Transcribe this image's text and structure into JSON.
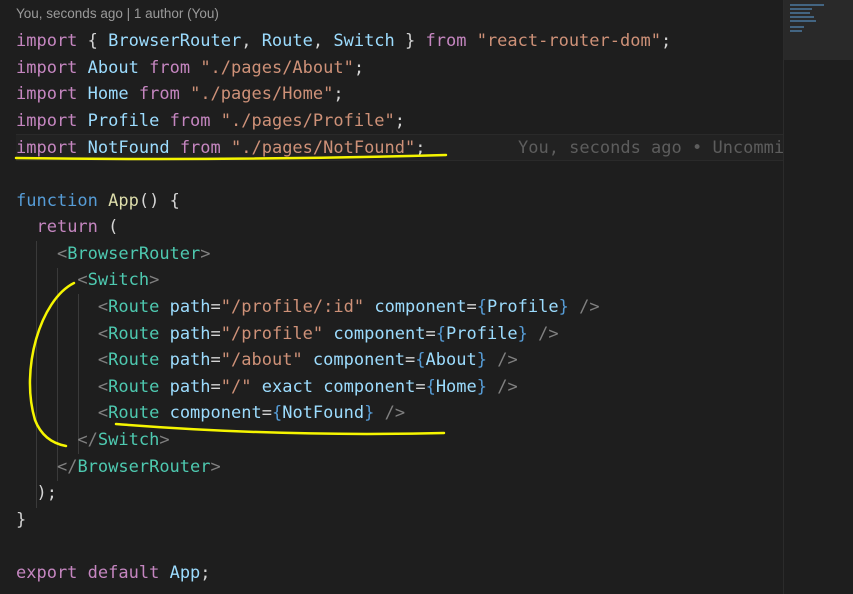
{
  "blame_header": "You, seconds ago | 1 author (You)",
  "colors": {
    "background": "#1e1e1e",
    "keyword": "#c586c0",
    "storage": "#569cd6",
    "function": "#dcdcaa",
    "variable": "#9cdcfe",
    "string": "#ce9178",
    "component": "#4ec9b0",
    "punctuation": "#d4d4d4",
    "tag_bracket": "#808080",
    "brace": "#569cd6",
    "annotation": "#f5f500"
  },
  "code_lines": [
    {
      "tokens": [
        {
          "t": "import",
          "c": "keyword"
        },
        {
          "t": " { ",
          "c": "punctuation"
        },
        {
          "t": "BrowserRouter",
          "c": "variable"
        },
        {
          "t": ", ",
          "c": "punctuation"
        },
        {
          "t": "Route",
          "c": "variable"
        },
        {
          "t": ", ",
          "c": "punctuation"
        },
        {
          "t": "Switch",
          "c": "variable"
        },
        {
          "t": " } ",
          "c": "punctuation"
        },
        {
          "t": "from",
          "c": "keyword"
        },
        {
          "t": " ",
          "c": "punctuation"
        },
        {
          "t": "\"react-router-dom\"",
          "c": "string"
        },
        {
          "t": ";",
          "c": "punctuation"
        }
      ]
    },
    {
      "tokens": [
        {
          "t": "import",
          "c": "keyword"
        },
        {
          "t": " ",
          "c": "punctuation"
        },
        {
          "t": "About",
          "c": "variable"
        },
        {
          "t": " ",
          "c": "punctuation"
        },
        {
          "t": "from",
          "c": "keyword"
        },
        {
          "t": " ",
          "c": "punctuation"
        },
        {
          "t": "\"./pages/About\"",
          "c": "string"
        },
        {
          "t": ";",
          "c": "punctuation"
        }
      ]
    },
    {
      "tokens": [
        {
          "t": "import",
          "c": "keyword"
        },
        {
          "t": " ",
          "c": "punctuation"
        },
        {
          "t": "Home",
          "c": "variable"
        },
        {
          "t": " ",
          "c": "punctuation"
        },
        {
          "t": "from",
          "c": "keyword"
        },
        {
          "t": " ",
          "c": "punctuation"
        },
        {
          "t": "\"./pages/Home\"",
          "c": "string"
        },
        {
          "t": ";",
          "c": "punctuation"
        }
      ]
    },
    {
      "tokens": [
        {
          "t": "import",
          "c": "keyword"
        },
        {
          "t": " ",
          "c": "punctuation"
        },
        {
          "t": "Profile",
          "c": "variable"
        },
        {
          "t": " ",
          "c": "punctuation"
        },
        {
          "t": "from",
          "c": "keyword"
        },
        {
          "t": " ",
          "c": "punctuation"
        },
        {
          "t": "\"./pages/Profile\"",
          "c": "string"
        },
        {
          "t": ";",
          "c": "punctuation"
        }
      ]
    },
    {
      "current": true,
      "inline_blame": "You, seconds ago • Uncommitted changes",
      "tokens": [
        {
          "t": "import",
          "c": "keyword"
        },
        {
          "t": " ",
          "c": "punctuation"
        },
        {
          "t": "NotFound",
          "c": "variable"
        },
        {
          "t": " ",
          "c": "punctuation"
        },
        {
          "t": "from",
          "c": "keyword"
        },
        {
          "t": " ",
          "c": "punctuation"
        },
        {
          "t": "\"./pages/NotFound\"",
          "c": "string"
        },
        {
          "t": ";",
          "c": "punctuation"
        }
      ]
    },
    {
      "tokens": []
    },
    {
      "tokens": [
        {
          "t": "function",
          "c": "storage"
        },
        {
          "t": " ",
          "c": "punctuation"
        },
        {
          "t": "App",
          "c": "function"
        },
        {
          "t": "() {",
          "c": "punctuation"
        }
      ]
    },
    {
      "tokens": [
        {
          "t": "  ",
          "c": "punctuation"
        },
        {
          "t": "return",
          "c": "keyword"
        },
        {
          "t": " (",
          "c": "punctuation"
        }
      ]
    },
    {
      "tokens": [
        {
          "t": "    ",
          "c": "punctuation"
        },
        {
          "t": "<",
          "c": "tag_bracket"
        },
        {
          "t": "BrowserRouter",
          "c": "component"
        },
        {
          "t": ">",
          "c": "tag_bracket"
        }
      ]
    },
    {
      "tokens": [
        {
          "t": "      ",
          "c": "punctuation"
        },
        {
          "t": "<",
          "c": "tag_bracket"
        },
        {
          "t": "Switch",
          "c": "component"
        },
        {
          "t": ">",
          "c": "tag_bracket"
        }
      ]
    },
    {
      "tokens": [
        {
          "t": "        ",
          "c": "punctuation"
        },
        {
          "t": "<",
          "c": "tag_bracket"
        },
        {
          "t": "Route",
          "c": "component"
        },
        {
          "t": " ",
          "c": "punctuation"
        },
        {
          "t": "path",
          "c": "variable"
        },
        {
          "t": "=",
          "c": "punctuation"
        },
        {
          "t": "\"/profile/:id\"",
          "c": "string"
        },
        {
          "t": " ",
          "c": "punctuation"
        },
        {
          "t": "component",
          "c": "variable"
        },
        {
          "t": "=",
          "c": "punctuation"
        },
        {
          "t": "{",
          "c": "brace"
        },
        {
          "t": "Profile",
          "c": "variable"
        },
        {
          "t": "}",
          "c": "brace"
        },
        {
          "t": " ",
          "c": "punctuation"
        },
        {
          "t": "/>",
          "c": "tag_bracket"
        }
      ]
    },
    {
      "tokens": [
        {
          "t": "        ",
          "c": "punctuation"
        },
        {
          "t": "<",
          "c": "tag_bracket"
        },
        {
          "t": "Route",
          "c": "component"
        },
        {
          "t": " ",
          "c": "punctuation"
        },
        {
          "t": "path",
          "c": "variable"
        },
        {
          "t": "=",
          "c": "punctuation"
        },
        {
          "t": "\"/profile\"",
          "c": "string"
        },
        {
          "t": " ",
          "c": "punctuation"
        },
        {
          "t": "component",
          "c": "variable"
        },
        {
          "t": "=",
          "c": "punctuation"
        },
        {
          "t": "{",
          "c": "brace"
        },
        {
          "t": "Profile",
          "c": "variable"
        },
        {
          "t": "}",
          "c": "brace"
        },
        {
          "t": " ",
          "c": "punctuation"
        },
        {
          "t": "/>",
          "c": "tag_bracket"
        }
      ]
    },
    {
      "tokens": [
        {
          "t": "        ",
          "c": "punctuation"
        },
        {
          "t": "<",
          "c": "tag_bracket"
        },
        {
          "t": "Route",
          "c": "component"
        },
        {
          "t": " ",
          "c": "punctuation"
        },
        {
          "t": "path",
          "c": "variable"
        },
        {
          "t": "=",
          "c": "punctuation"
        },
        {
          "t": "\"/about\"",
          "c": "string"
        },
        {
          "t": " ",
          "c": "punctuation"
        },
        {
          "t": "component",
          "c": "variable"
        },
        {
          "t": "=",
          "c": "punctuation"
        },
        {
          "t": "{",
          "c": "brace"
        },
        {
          "t": "About",
          "c": "variable"
        },
        {
          "t": "}",
          "c": "brace"
        },
        {
          "t": " ",
          "c": "punctuation"
        },
        {
          "t": "/>",
          "c": "tag_bracket"
        }
      ]
    },
    {
      "tokens": [
        {
          "t": "        ",
          "c": "punctuation"
        },
        {
          "t": "<",
          "c": "tag_bracket"
        },
        {
          "t": "Route",
          "c": "component"
        },
        {
          "t": " ",
          "c": "punctuation"
        },
        {
          "t": "path",
          "c": "variable"
        },
        {
          "t": "=",
          "c": "punctuation"
        },
        {
          "t": "\"/\"",
          "c": "string"
        },
        {
          "t": " ",
          "c": "punctuation"
        },
        {
          "t": "exact",
          "c": "variable"
        },
        {
          "t": " ",
          "c": "punctuation"
        },
        {
          "t": "component",
          "c": "variable"
        },
        {
          "t": "=",
          "c": "punctuation"
        },
        {
          "t": "{",
          "c": "brace"
        },
        {
          "t": "Home",
          "c": "variable"
        },
        {
          "t": "}",
          "c": "brace"
        },
        {
          "t": " ",
          "c": "punctuation"
        },
        {
          "t": "/>",
          "c": "tag_bracket"
        }
      ]
    },
    {
      "tokens": [
        {
          "t": "        ",
          "c": "punctuation"
        },
        {
          "t": "<",
          "c": "tag_bracket"
        },
        {
          "t": "Route",
          "c": "component"
        },
        {
          "t": " ",
          "c": "punctuation"
        },
        {
          "t": "component",
          "c": "variable"
        },
        {
          "t": "=",
          "c": "punctuation"
        },
        {
          "t": "{",
          "c": "brace"
        },
        {
          "t": "NotFound",
          "c": "variable"
        },
        {
          "t": "}",
          "c": "brace"
        },
        {
          "t": " ",
          "c": "punctuation"
        },
        {
          "t": "/>",
          "c": "tag_bracket"
        }
      ]
    },
    {
      "tokens": [
        {
          "t": "      ",
          "c": "punctuation"
        },
        {
          "t": "</",
          "c": "tag_bracket"
        },
        {
          "t": "Switch",
          "c": "component"
        },
        {
          "t": ">",
          "c": "tag_bracket"
        }
      ]
    },
    {
      "tokens": [
        {
          "t": "    ",
          "c": "punctuation"
        },
        {
          "t": "</",
          "c": "tag_bracket"
        },
        {
          "t": "BrowserRouter",
          "c": "component"
        },
        {
          "t": ">",
          "c": "tag_bracket"
        }
      ]
    },
    {
      "tokens": [
        {
          "t": "  );",
          "c": "punctuation"
        }
      ]
    },
    {
      "tokens": [
        {
          "t": "}",
          "c": "punctuation"
        }
      ]
    },
    {
      "tokens": []
    },
    {
      "tokens": [
        {
          "t": "export",
          "c": "keyword"
        },
        {
          "t": " ",
          "c": "punctuation"
        },
        {
          "t": "default",
          "c": "keyword"
        },
        {
          "t": " ",
          "c": "punctuation"
        },
        {
          "t": "App",
          "c": "variable"
        },
        {
          "t": ";",
          "c": "punctuation"
        }
      ]
    }
  ]
}
